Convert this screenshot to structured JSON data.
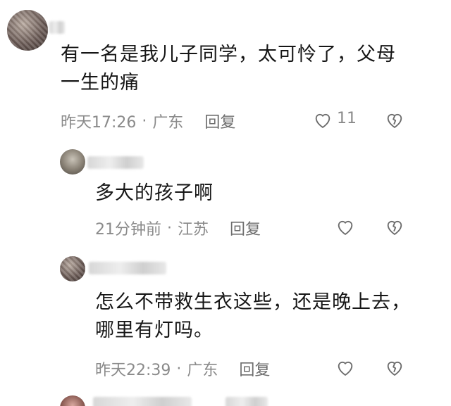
{
  "comments": [
    {
      "text": "有一名是我儿子同学，太可怜了，父母一生的痛",
      "time": "昨天17:26",
      "location": "广东",
      "reply": "回复",
      "likes": "11"
    },
    {
      "text": "多大的孩子啊",
      "time": "21分钟前",
      "location": "江苏",
      "reply": "回复"
    },
    {
      "text": "怎么不带救生衣这些，还是晚上去，哪里有灯吗。",
      "time": "昨天22:39",
      "location": "广东",
      "reply": "回复"
    }
  ],
  "separator": "·",
  "icons": {
    "like": "heart-outline-icon",
    "dislike": "broken-heart-icon"
  }
}
